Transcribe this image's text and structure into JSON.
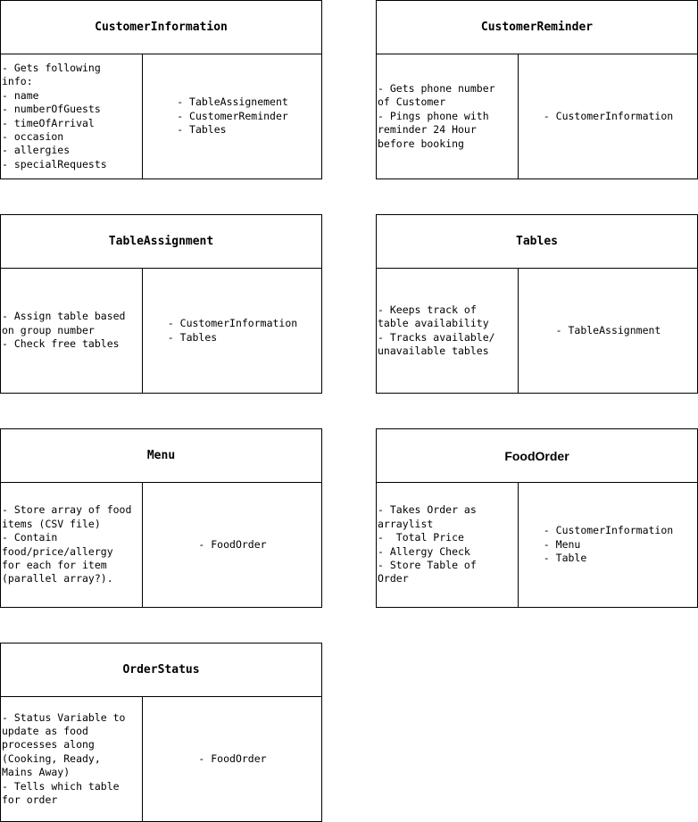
{
  "diagram": {
    "cards": [
      {
        "id": "customer-information",
        "title": "CustomerInformation",
        "responsibilities": [
          "- Gets following",
          "info:",
          "- name",
          "- numberOfGuests",
          "- timeOfArrival",
          "- occasion",
          "- allergies",
          "- specialRequests"
        ],
        "collaborators": [
          "- TableAssignement",
          "- CustomerReminder",
          "- Tables"
        ]
      },
      {
        "id": "customer-reminder",
        "title": "CustomerReminder",
        "responsibilities": [
          "- Gets phone number",
          "of Customer",
          "- Pings phone with",
          "reminder 24 Hour",
          "before booking"
        ],
        "collaborators": [
          "- CustomerInformation"
        ]
      },
      {
        "id": "table-assignment",
        "title": "TableAssignment",
        "responsibilities": [
          "- Assign table based",
          "on group number",
          "- Check free tables"
        ],
        "collaborators": [
          "- CustomerInformation",
          "- Tables"
        ]
      },
      {
        "id": "tables",
        "title": "Tables",
        "responsibilities": [
          "- Keeps track of",
          "table availability",
          "- Tracks available/",
          "unavailable tables"
        ],
        "collaborators": [
          "- TableAssignment"
        ]
      },
      {
        "id": "menu",
        "title": "Menu",
        "responsibilities": [
          "- Store array of food",
          "items (CSV file)",
          "- Contain",
          "food/price/allergy",
          "for each for item",
          "(parallel array?)."
        ],
        "collaborators": [
          "- FoodOrder"
        ]
      },
      {
        "id": "food-order",
        "title": "FoodOrder",
        "responsibilities": [
          "- Takes Order as",
          "arraylist",
          "-  Total Price",
          "- Allergy Check",
          "- Store Table of",
          "Order"
        ],
        "collaborators": [
          "- CustomerInformation",
          "- Menu",
          "- Table"
        ]
      },
      {
        "id": "order-status",
        "title": "OrderStatus",
        "responsibilities": [
          "- Status Variable to",
          "update as food",
          "processes along",
          "(Cooking, Ready,",
          "Mains Away)",
          "- Tells which table",
          "for order"
        ],
        "collaborators": [
          "- FoodOrder"
        ]
      }
    ]
  }
}
